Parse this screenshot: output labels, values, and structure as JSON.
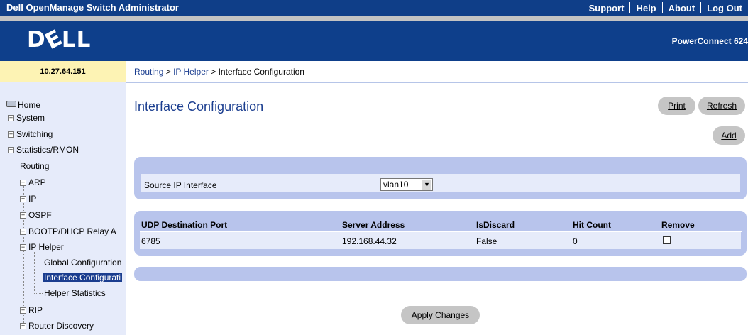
{
  "header": {
    "app_title": "Dell OpenManage Switch Administrator",
    "links": [
      "Support",
      "Help",
      "About",
      "Log Out"
    ],
    "logo": "DELL",
    "model": "PowerConnect 624"
  },
  "ip_address": "10.27.64.151",
  "breadcrumb": {
    "routing": "Routing",
    "sep1": " > ",
    "ip_helper": "IP Helper",
    "sep2": " > ",
    "current": "Interface Configuration"
  },
  "nav": {
    "home": "Home",
    "system": "System",
    "switching": "Switching",
    "statistics": "Statistics/RMON",
    "routing": "Routing",
    "arp": "ARP",
    "ip": "IP",
    "ospf": "OSPF",
    "bootp": "BOOTP/DHCP Relay A",
    "ip_helper": "IP Helper",
    "global_config": "Global Configuration",
    "interface_config": "Interface Configurati",
    "helper_stats": "Helper Statistics",
    "rip": "RIP",
    "router_discovery": "Router Discovery",
    "expand_symbol": "+",
    "collapse_symbol": "−"
  },
  "page": {
    "title": "Interface Configuration",
    "print_label": "Print",
    "refresh_label": "Refresh",
    "add_label": "Add",
    "apply_label": "Apply Changes"
  },
  "form": {
    "source_ip_label": "Source IP Interface",
    "source_ip_value": "vlan10",
    "dropdown_arrow": "▼"
  },
  "table": {
    "headers": [
      "UDP Destination Port",
      "Server Address",
      "IsDiscard",
      "Hit Count",
      "Remove"
    ],
    "rows": [
      {
        "udp_port": "6785",
        "server": "192.168.44.32",
        "is_discard": "False",
        "hit_count": "0",
        "remove": false
      }
    ]
  },
  "colors": {
    "header_blue": "#0e3f8b",
    "sidebar_bg": "#e6ebfa",
    "panel_border": "#b8c4ec",
    "ip_bg": "#fdf3b4",
    "title_blue": "#1a3d8f"
  }
}
